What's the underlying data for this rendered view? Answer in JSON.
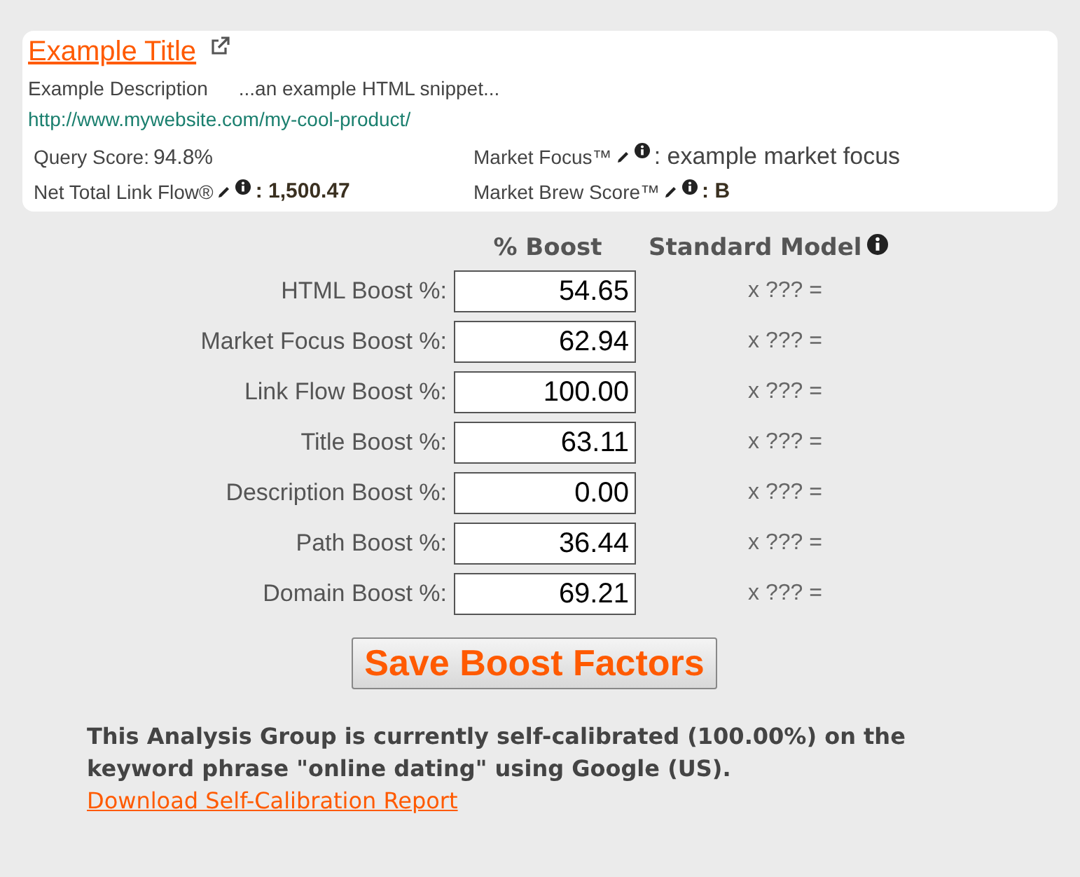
{
  "card": {
    "title": "Example Title",
    "description": "Example Description",
    "snippet": "...an example HTML snippet...",
    "url": "http://www.mywebsite.com/my-cool-product/",
    "stats": [
      {
        "label": "Query Score:",
        "value": "94.8%",
        "editable": false,
        "bold": false
      },
      {
        "label": "Market Focus™",
        "value": ": example market focus",
        "editable": true,
        "bold": false
      },
      {
        "label": "Net Total Link Flow®",
        "value": ": 1,500.47",
        "editable": true,
        "bold": true
      },
      {
        "label": "Market Brew Score™",
        "value": ": B",
        "editable": true,
        "bold": true
      }
    ]
  },
  "columns": [
    "% Boost",
    "Standard Model"
  ],
  "rows": [
    {
      "label": "HTML Boost %:",
      "value": "54.65",
      "model": "x ??? ="
    },
    {
      "label": "Market Focus Boost %:",
      "value": "62.94",
      "model": "x ??? ="
    },
    {
      "label": "Link Flow Boost %:",
      "value": "100.00",
      "model": "x ??? ="
    },
    {
      "label": "Title Boost %:",
      "value": "63.11",
      "model": "x ??? ="
    },
    {
      "label": "Description Boost %:",
      "value": "0.00",
      "model": "x ??? ="
    },
    {
      "label": "Path Boost %:",
      "value": "36.44",
      "model": "x ??? ="
    },
    {
      "label": "Domain Boost %:",
      "value": "69.21",
      "model": "x ??? ="
    }
  ],
  "save_button": "Save Boost Factors",
  "footer": {
    "text": "This Analysis Group is currently self-calibrated (100.00%) on the keyword phrase \"online dating\" using Google (US).",
    "link": "Download Self-Calibration Report"
  }
}
